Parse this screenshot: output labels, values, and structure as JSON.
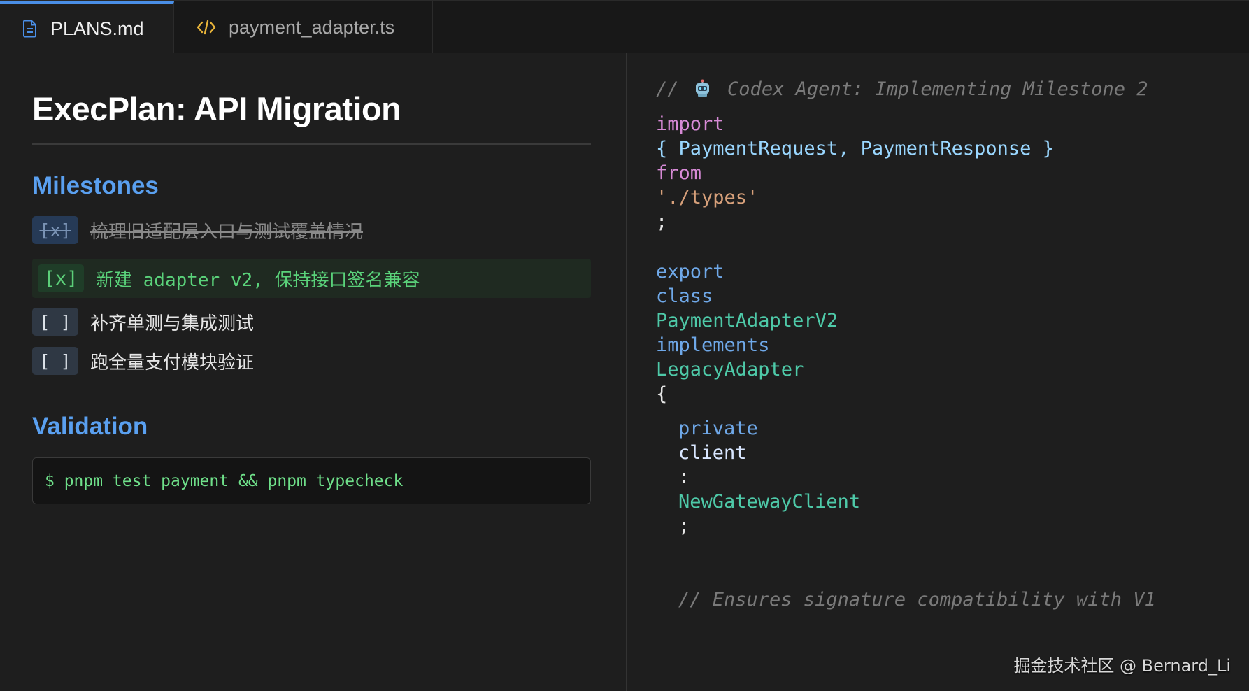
{
  "tabs": [
    {
      "label": "PLANS.md",
      "icon": "document-icon",
      "active": true
    },
    {
      "label": "payment_adapter.ts",
      "icon": "code-icon",
      "active": false
    }
  ],
  "plan": {
    "title": "ExecPlan: API Migration",
    "milestones_heading": "Milestones",
    "milestones": [
      {
        "box": "[x]",
        "text": "梳理旧适配层入口与测试覆盖情况",
        "state": "done"
      },
      {
        "box": "[x]",
        "text": "新建 adapter v2, 保持接口签名兼容",
        "state": "in-progress"
      },
      {
        "box": "[ ]",
        "text": "补齐单测与集成测试",
        "state": "todo"
      },
      {
        "box": "[ ]",
        "text": "跑全量支付模块验证",
        "state": "todo"
      }
    ],
    "validation_heading": "Validation",
    "validation_command": "$ pnpm test payment && pnpm typecheck"
  },
  "code": {
    "header_comment_prefix": "//",
    "header_comment_text": "Codex Agent: Implementing Milestone 2",
    "tokens": {
      "import": "import",
      "import_names": "{ PaymentRequest, PaymentResponse }",
      "from": "from",
      "module_path": "'./types'",
      "semicolon": ";",
      "export": "export",
      "class": "class",
      "class_name": "PaymentAdapterV2",
      "implements": "implements",
      "interface_name": "LegacyAdapter",
      "open_brace": "{",
      "private": "private",
      "field_name": "client",
      "colon": ":",
      "field_type": "NewGatewayClient",
      "field_semicolon": ";",
      "trailing_comment": "// Ensures signature compatibility with V1"
    }
  },
  "watermark": "掘金技术社区 @ Bernard_Li",
  "colors": {
    "background": "#1e1e1e",
    "heading_blue": "#5aa0f0",
    "active_green": "#5ad27a",
    "keyword_pink": "#d78ad6",
    "keyword_blue": "#6fa8e8",
    "type_teal": "#4ec9a8",
    "string": "#d7a07a"
  }
}
